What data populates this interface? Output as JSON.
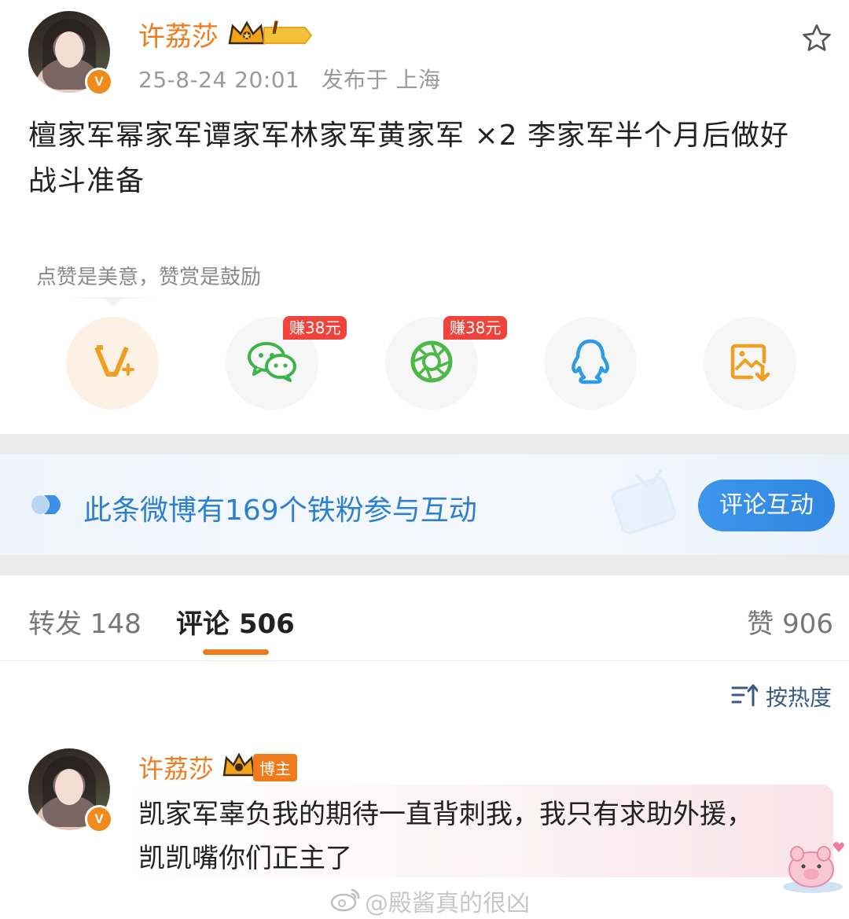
{
  "post": {
    "author": "许荔莎",
    "level_badge": "I",
    "date": "25-8-24 20:01",
    "location": "发布于 上海",
    "text_line1": "檀家军幂家军谭家军林家军黄家军 ×2 李家军半个月后做好",
    "text_line2": "战斗准备"
  },
  "share": {
    "tip": "点赞是美意，赞赏是鼓励",
    "earn_wechat": "赚38元",
    "earn_moments": "赚38元",
    "items": [
      "v-plus-icon",
      "wechat-icon",
      "moments-icon",
      "qq-icon",
      "save-image-icon"
    ]
  },
  "banner": {
    "text": "此条微博有169个铁粉参与互动",
    "button": "评论互动"
  },
  "tabs": {
    "repost": "转发 148",
    "comment": "评论 506",
    "like": "赞 906"
  },
  "sort": {
    "label": "按热度"
  },
  "comment": {
    "author": "许荔莎",
    "role_badge": "博主",
    "line1": "凯家军辜负我的期待一直背刺我，我只有求助外援，",
    "line2": "凯凯嘴你们正主了"
  },
  "watermark": "@殿酱真的很凶",
  "colors": {
    "accent": "#f07b1d",
    "link_blue": "#2d7fd3",
    "earn_red": "#f0433b"
  }
}
